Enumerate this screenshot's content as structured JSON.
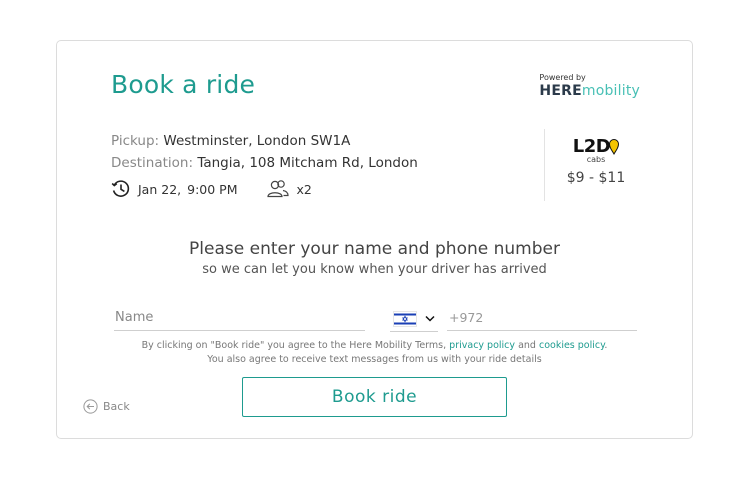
{
  "colors": {
    "accent": "#1e9b8f",
    "brand_dark": "#2b3a4a",
    "brand_light": "#48c0b5",
    "provider_yellow": "#f4c400"
  },
  "header": {
    "title": "Book a ride"
  },
  "powered_by": {
    "label": "Powered by",
    "brand_part1": "HERE",
    "brand_part2": "mobility"
  },
  "ride": {
    "pickup_label": "Pickup:",
    "pickup_value": "Westminster, London SW1A",
    "destination_label": "Destination:",
    "destination_value": "Tangia, 108 Mitcham Rd, London",
    "date": "Jan 22,",
    "time": "9:00 PM",
    "passengers": "x2",
    "icons": {
      "time": "clock-icon",
      "passengers": "passengers-icon"
    }
  },
  "provider": {
    "logo_text": "L2D",
    "logo_sub": "cabs",
    "price": "$9 - $11"
  },
  "form": {
    "prompt": "Please enter your name and phone number",
    "prompt_sub": "so we can let you know when your driver has arrived",
    "name_placeholder": "Name",
    "country_flag": "israel-flag",
    "phone_placeholder": "+972"
  },
  "terms": {
    "line1_prefix": "By clicking on \"Book ride\" you agree to the Here Mobility Terms,",
    "privacy_link": "privacy policy",
    "and": "and",
    "cookies_link": "cookies policy",
    "line1_suffix": ".",
    "line2": "You also agree to receive text messages from us with your ride details"
  },
  "footer": {
    "back_label": "Back",
    "book_button": "Book ride"
  }
}
